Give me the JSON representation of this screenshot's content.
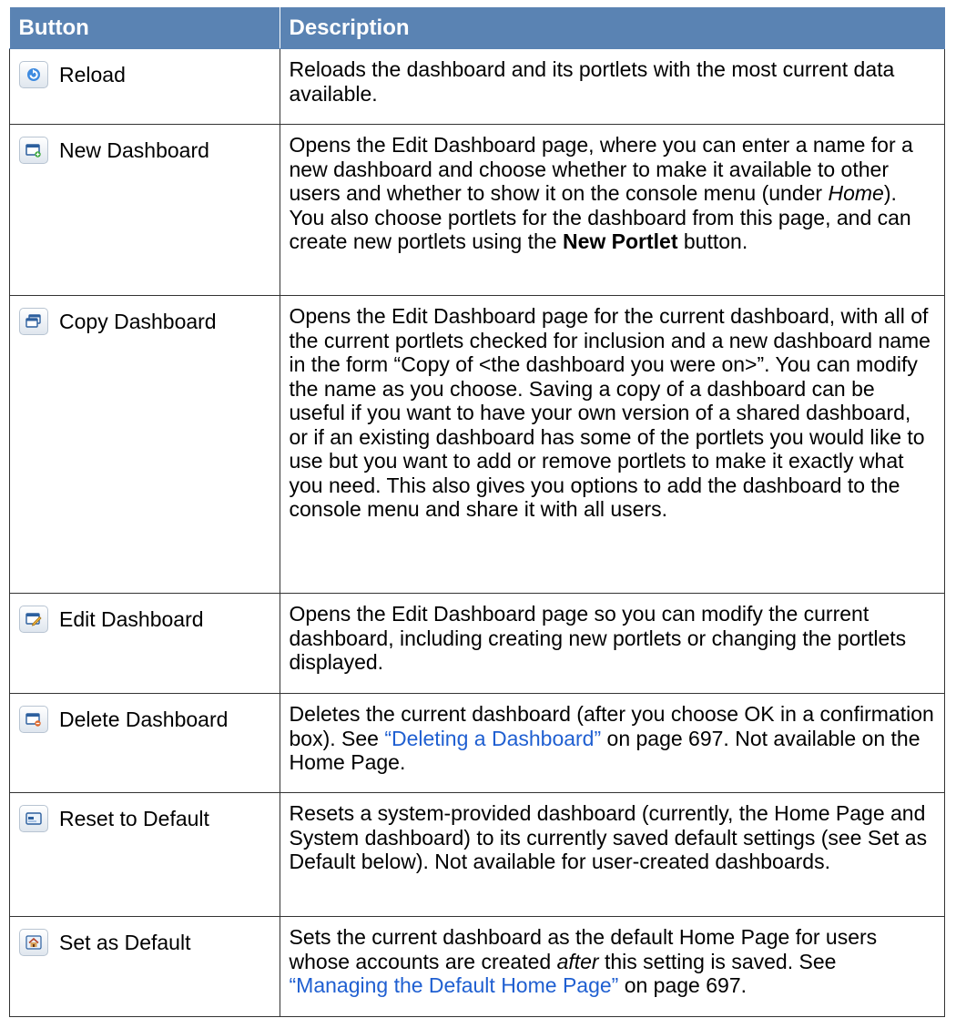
{
  "header": {
    "col1": "Button",
    "col2": "Description"
  },
  "rows": [
    {
      "label": "Reload",
      "desc": {
        "a": "Reloads the dashboard and its portlets with the most current data available."
      }
    },
    {
      "label": "New Dashboard",
      "desc": {
        "a": "Opens the Edit Dashboard page, where you can enter a name for a new dashboard and choose whether to make it available to other users and whether to show it on the console menu (under ",
        "b": "Home",
        "c": "). You also choose portlets for the dashboard from this page, and can create new portlets using the ",
        "d": "New Portlet",
        "e": " button."
      }
    },
    {
      "label": "Copy Dashboard",
      "desc": {
        "a": "Opens the Edit Dashboard page for the current dashboard, with all of the current portlets checked for inclusion and a new dashboard name in the form “Copy of <the dashboard you were on>”. You can modify the name as you choose. Saving a copy of a dashboard can be useful if you want to have your own version of a shared dashboard, or if an existing dashboard has some of the portlets you would like to use but you want to add or remove portlets to make it exactly what you need. This also gives you options to add the dashboard to the console menu and share it with all users."
      }
    },
    {
      "label": "Edit Dashboard",
      "desc": {
        "a": "Opens the Edit Dashboard page so you can modify the current dashboard, including creating new portlets or changing the portlets displayed."
      }
    },
    {
      "label": "Delete Dashboard",
      "desc": {
        "a": "Deletes the current dashboard (after you choose OK in a confirmation box). See ",
        "link": "“Deleting a Dashboard”",
        "b": " on page 697. Not available on the Home Page."
      }
    },
    {
      "label": "Reset to Default",
      "desc": {
        "a": "Resets a system-provided dashboard (currently, the Home Page and System dashboard) to its currently saved default settings (see Set as Default below). Not available for user-created dashboards."
      }
    },
    {
      "label": "Set as Default",
      "desc": {
        "a": "Sets the current dashboard as the default Home Page for users whose accounts are created ",
        "b": "after",
        "c": " this setting is saved. See ",
        "link": "“Managing the Default Home Page”",
        "d": " on page 697."
      }
    }
  ],
  "icons": [
    "reload-icon",
    "new-dashboard-icon",
    "copy-dashboard-icon",
    "edit-dashboard-icon",
    "delete-dashboard-icon",
    "reset-to-default-icon",
    "set-as-default-icon"
  ],
  "colors": {
    "header_bg": "#5a83b3",
    "link": "#1f5fd1"
  }
}
